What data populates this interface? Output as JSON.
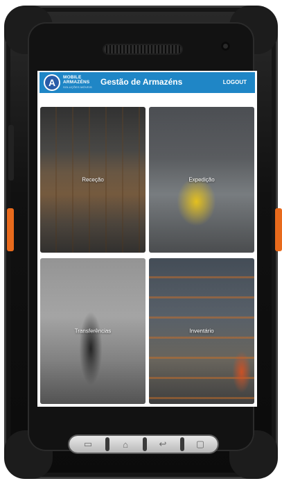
{
  "header": {
    "logo_letter": "A",
    "brand_line1": "MOBILE",
    "brand_line2": "ARMAZÉNS",
    "brand_tagline": "SOLUÇÕES MÓVEIS",
    "title": "Gestão de Armazéns",
    "logout_label": "LOGOUT",
    "bar_color": "#1f86c6"
  },
  "tiles": [
    {
      "label": "Receção"
    },
    {
      "label": "Expedição"
    },
    {
      "label": "Transferências"
    },
    {
      "label": "Inventário"
    }
  ],
  "device": {
    "accent_color": "#e86a1c",
    "nav_icons": [
      "recent-apps-icon",
      "home-icon",
      "back-icon",
      "menu-icon"
    ]
  }
}
